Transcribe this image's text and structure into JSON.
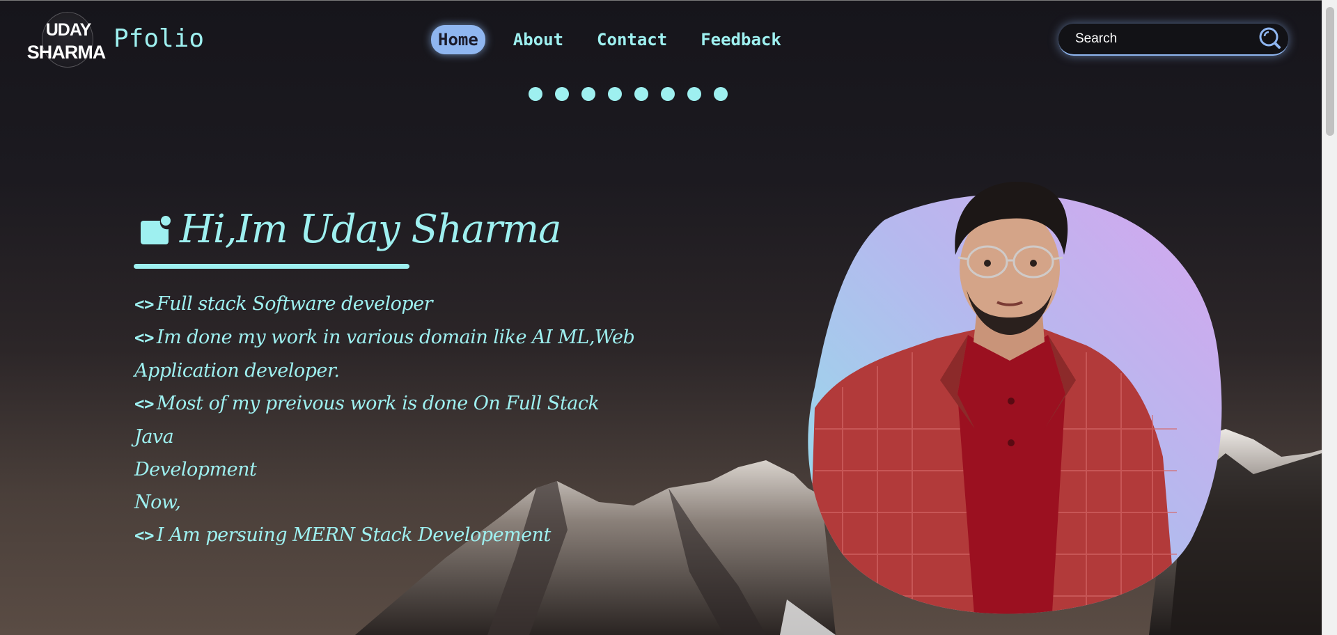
{
  "brand": {
    "logo_line1": "UDAY",
    "logo_line2": "SHARMA",
    "name": "Pfolio"
  },
  "nav": {
    "items": [
      {
        "label": "Home",
        "active": true
      },
      {
        "label": "About",
        "active": false
      },
      {
        "label": "Contact",
        "active": false
      },
      {
        "label": "Feedback",
        "active": false
      }
    ]
  },
  "search": {
    "placeholder": "Search"
  },
  "carousel": {
    "dot_count": 8
  },
  "intro": {
    "title": "Hi,Im Uday Sharma",
    "code_glyph": "<>",
    "line1": "Full stack Software developer",
    "line2a": "Im done my work in various domain like AI ML,Web",
    "line2b": "Application developer.",
    "line3a": "Most of my preivous work is done On Full Stack Java",
    "line3b": "Development",
    "line4": "Now,",
    "line5": "I Am persuing MERN Stack Developement"
  },
  "colors": {
    "accent": "#9ef0f0",
    "nav_active_bg": "#8fb6f0",
    "background_top": "#16151b",
    "blob_start": "#8fe3ea",
    "blob_end": "#d6a6ef"
  },
  "icons": {
    "search": "search-icon",
    "note": "note-icon"
  }
}
